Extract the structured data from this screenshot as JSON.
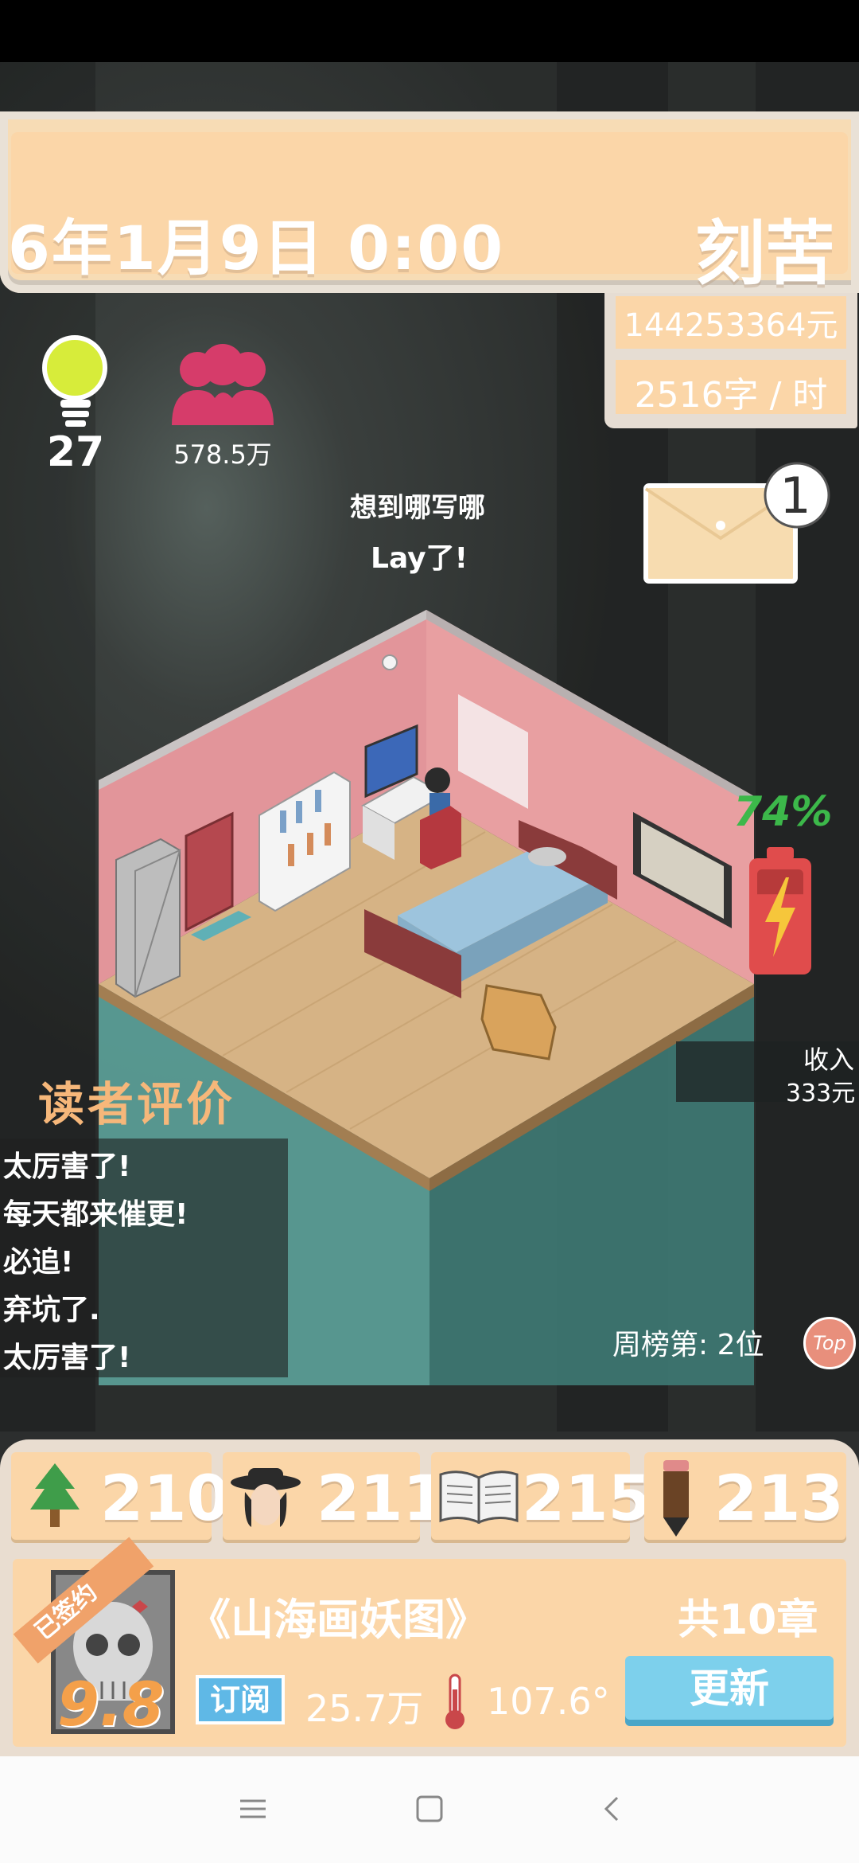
{
  "header": {
    "date_time": "6年1月9日    0:00",
    "mode": "刻苦",
    "money": "144253364元",
    "writing_speed": "2516字 / 时"
  },
  "hud": {
    "inspiration_value": "27",
    "fans_value": "578.5万",
    "mail_count": "1"
  },
  "thought_bubble": {
    "line1": "想到哪写哪",
    "line2": "Lay了!"
  },
  "battery": {
    "percent_label": "74%",
    "level": 0.74
  },
  "income": {
    "label": "收入",
    "value": "333元"
  },
  "reviews": {
    "title": "读者评价",
    "items": [
      "太厉害了!",
      "每天都来催更!",
      "必追!",
      "弃坑了.",
      "太厉害了!"
    ]
  },
  "ranking": {
    "text": "周榜第: 2位",
    "badge": "Top"
  },
  "stats": [
    {
      "icon": "tree-icon",
      "value": "210"
    },
    {
      "icon": "character-icon",
      "value": "211"
    },
    {
      "icon": "book-icon",
      "value": "215"
    },
    {
      "icon": "pencil-icon",
      "value": "213"
    }
  ],
  "book": {
    "signed_label": "已签约",
    "score": "9.8",
    "title": "《山海画妖图》",
    "chapters": "共10章",
    "subscribe_label": "订阅",
    "subscribers": "25.7万",
    "heat": "107.6°",
    "update_label": "更新"
  },
  "colors": {
    "banner": "#fbd6a8",
    "accent_orange": "#f6b77a",
    "battery_green": "#3cb84a",
    "battery_red": "#e04c4c",
    "button_blue": "#7dd0ec"
  }
}
